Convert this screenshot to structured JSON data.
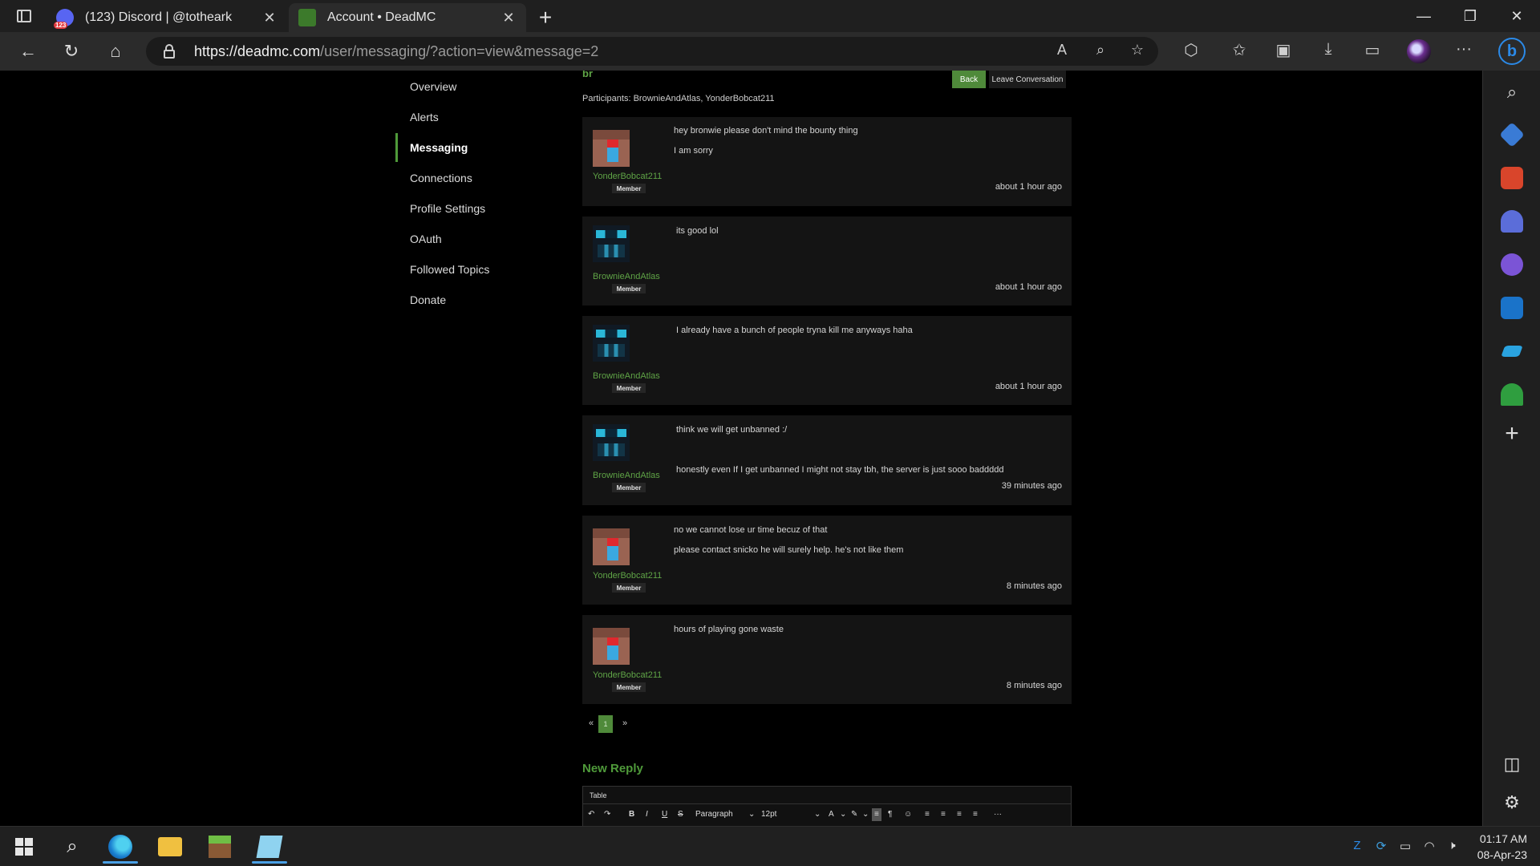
{
  "browser": {
    "tabs": [
      {
        "title": "(123) Discord | @totheark",
        "active": false
      },
      {
        "title": "Account • DeadMC",
        "active": true
      }
    ],
    "url_host": "https://deadmc.com",
    "url_path": "/user/messaging/?action=view&message=2"
  },
  "account_nav": {
    "items": [
      {
        "label": "Overview"
      },
      {
        "label": "Alerts"
      },
      {
        "label": "Messaging"
      },
      {
        "label": "Connections"
      },
      {
        "label": "Profile Settings"
      },
      {
        "label": "OAuth"
      },
      {
        "label": "Followed Topics"
      },
      {
        "label": "Donate"
      }
    ],
    "active": "Messaging"
  },
  "conversation": {
    "title": "br",
    "participants": "Participants: BrownieAndAtlas, YonderBobcat211",
    "back_label": "Back",
    "leave_label": "Leave Conversation",
    "messages": [
      {
        "author": "YonderBobcat211",
        "role": "Member",
        "lines": [
          "hey bronwie please don't mind the bounty thing",
          "I am sorry"
        ],
        "time": "about 1 hour ago"
      },
      {
        "author": "BrownieAndAtlas",
        "role": "Member",
        "lines": [
          "its good lol"
        ],
        "time": "about 1 hour ago"
      },
      {
        "author": "BrownieAndAtlas",
        "role": "Member",
        "lines": [
          "I already have a bunch of people tryna kill me anyways haha"
        ],
        "time": "about 1 hour ago"
      },
      {
        "author": "BrownieAndAtlas",
        "role": "Member",
        "lines": [
          "think we will get unbanned :/",
          "honestly even If I get unbanned I might not stay tbh, the server is just sooo baddddd"
        ],
        "time": "39 minutes ago"
      },
      {
        "author": "YonderBobcat211",
        "role": "Member",
        "lines": [
          "no we cannot lose ur time becuz of that",
          "please contact snicko he will surely help. he's not like them"
        ],
        "time": "8 minutes ago"
      },
      {
        "author": "YonderBobcat211",
        "role": "Member",
        "lines": [
          "hours of playing gone waste"
        ],
        "time": "8 minutes ago"
      }
    ],
    "pagination": {
      "prev": "«",
      "current": "1",
      "next": "»"
    },
    "new_reply_label": "New Reply",
    "editor": {
      "menu_label": "Table",
      "block_format": "Paragraph",
      "font_size": "12pt"
    }
  },
  "taskbar": {
    "time": "01:17 AM",
    "date": "08-Apr-23"
  },
  "colors": {
    "accent_green": "#4f9a3a",
    "page_bg": "#000000",
    "message_bg": "#141414"
  }
}
